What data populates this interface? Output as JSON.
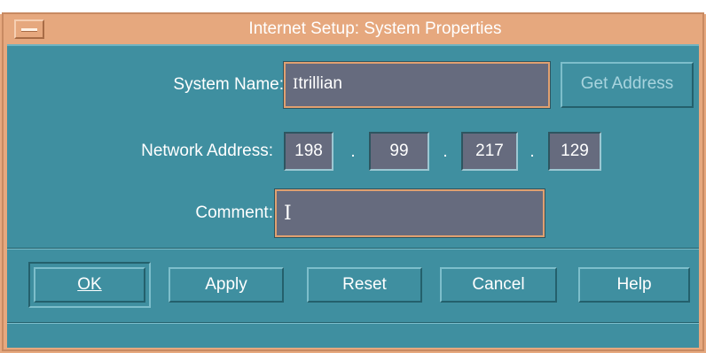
{
  "window": {
    "title": "Internet Setup: System Properties"
  },
  "form": {
    "system_name": {
      "label": "System Name:",
      "value": "trillian"
    },
    "get_address_label": "Get Address",
    "network_address": {
      "label": "Network Address:",
      "octets": [
        "198",
        "99",
        "217",
        "129"
      ],
      "separator": "."
    },
    "comment": {
      "label": "Comment:",
      "value": ""
    }
  },
  "buttons": {
    "ok": "OK",
    "apply": "Apply",
    "reset": "Reset",
    "cancel": "Cancel",
    "help": "Help"
  },
  "colors": {
    "title_bar": "#e6a87e",
    "client_bg": "#3f8fa0",
    "field_bg": "#666b7e",
    "text": "#ffffff",
    "disabled_text": "#a8d4de"
  },
  "icons": {
    "window_menu": "window-menu-icon",
    "text_cursor": "text-cursor-icon"
  }
}
